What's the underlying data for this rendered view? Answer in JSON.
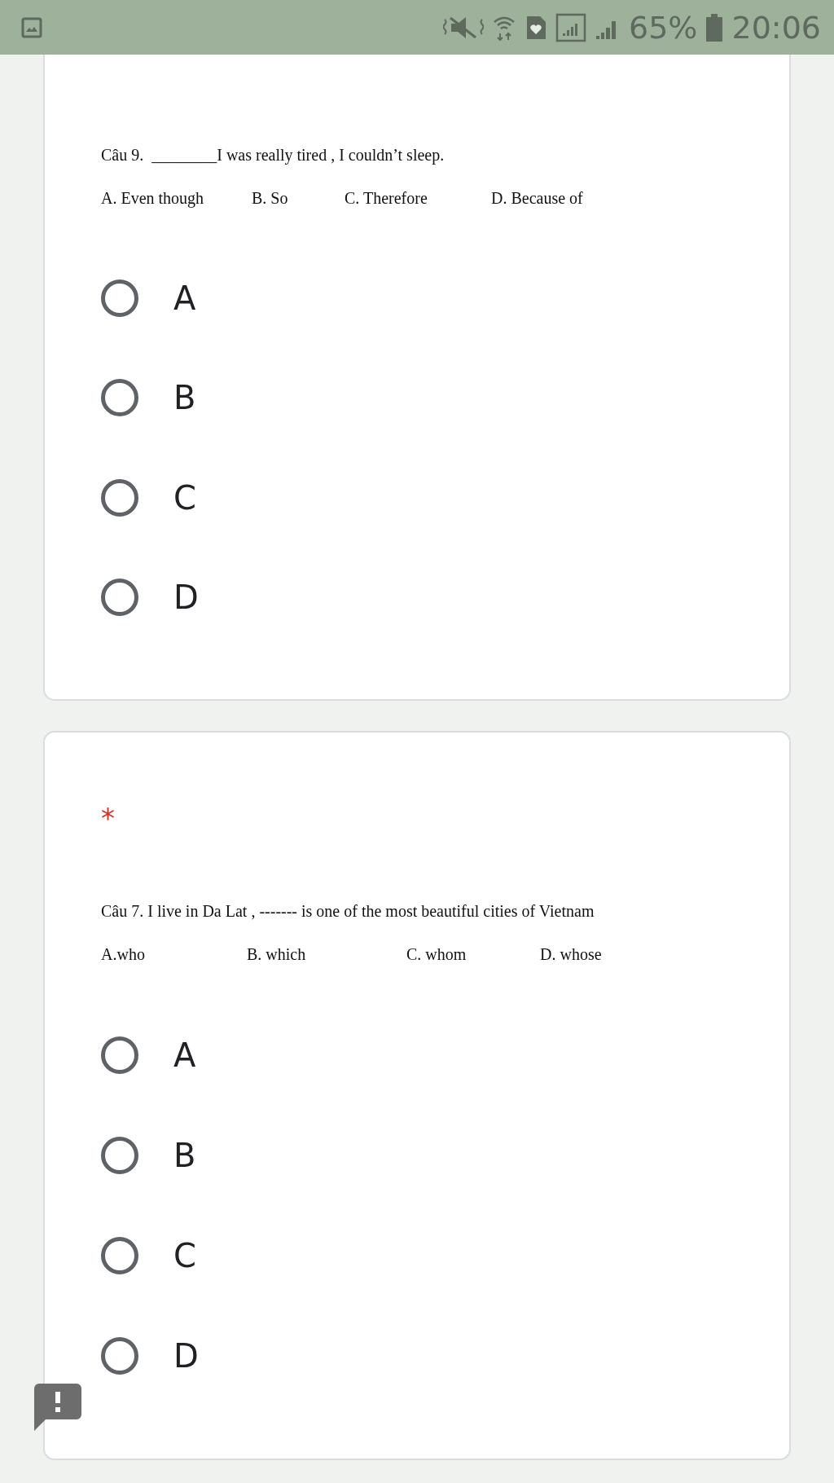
{
  "status_bar": {
    "battery": "65%",
    "time": "20:06"
  },
  "questions": [
    {
      "required": false,
      "text": "Câu 9.  ________I was really tired , I couldn’t sleep.",
      "options_text": [
        "A. Even though",
        "B. So",
        "C. Therefore",
        "D. Because of"
      ],
      "choices": [
        {
          "label": "A",
          "selected": false
        },
        {
          "label": "B",
          "selected": false
        },
        {
          "label": "C",
          "selected": false
        },
        {
          "label": "D",
          "selected": false
        }
      ]
    },
    {
      "required": true,
      "required_mark": "*",
      "text": "Câu 7. I live in Da Lat , ------- is one of the most beautiful cities of Vietnam",
      "options_text": [
        "A.who",
        "B. which",
        "C. whom",
        "D. whose"
      ],
      "choices": [
        {
          "label": "A",
          "selected": false
        },
        {
          "label": "B",
          "selected": false
        },
        {
          "label": "C",
          "selected": false
        },
        {
          "label": "D",
          "selected": false
        }
      ]
    }
  ]
}
